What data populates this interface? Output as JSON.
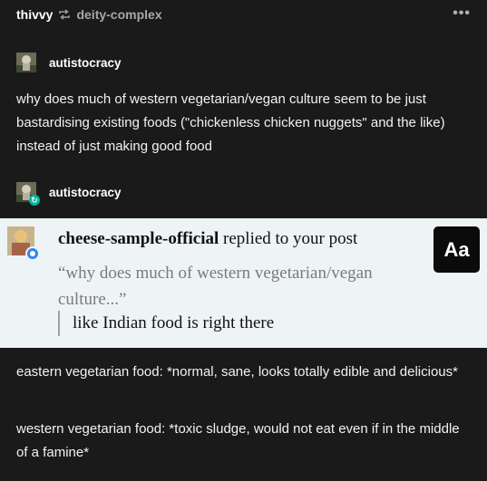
{
  "header": {
    "username": "thivvy",
    "source": "deity-complex",
    "more": "•••"
  },
  "post1": {
    "author": "autistocracy",
    "text": "why does much of western vegetarian/vegan culture seem to be just bastardising existing foods (\"chickenless chicken nuggets\" and the like) instead of just making good food"
  },
  "post2": {
    "author": "autistocracy"
  },
  "reply": {
    "name": "cheese-sample-official",
    "action": " replied to your post",
    "quote": "“why does much of western vegetarian/vegan culture...”",
    "text": "like Indian food is right there",
    "aa": "Aa"
  },
  "post3": {
    "para1": "eastern vegetarian food: *normal, sane, looks totally edible and delicious*",
    "para2": "western vegetarian food: *toxic sludge, would not eat even if in the middle of a famine*"
  }
}
